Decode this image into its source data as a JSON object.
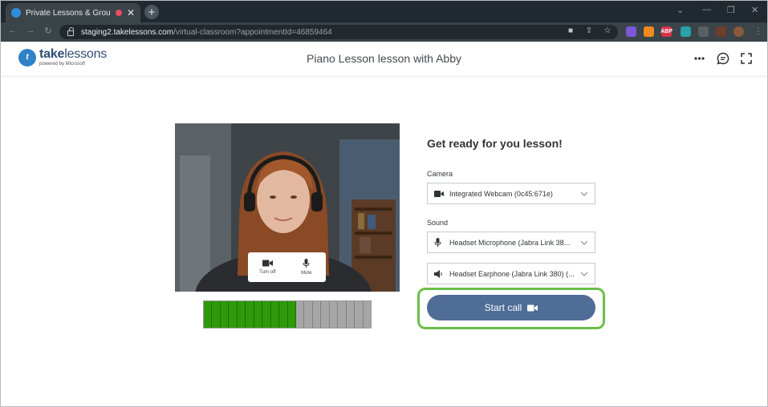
{
  "browser": {
    "tab_title": "Private Lessons & Group Cla",
    "tab_close": "✕",
    "new_tab": "+",
    "url_host": "staging2.takelessons.com",
    "url_path": "/virtual-classroom?appointmentId=46859464"
  },
  "header": {
    "logo_mark": "t",
    "logo_take": "take",
    "logo_lessons": "lessons",
    "logo_sub": "powered by Microsoft",
    "lesson_title": "Piano Lesson lesson with Abby",
    "more_icon": "more-horizontal-icon",
    "chat_icon": "chat-icon",
    "fullscreen_icon": "fullscreen-icon"
  },
  "video": {
    "camera_label": "Turn off",
    "mic_label": "Mute"
  },
  "meter": {
    "level": 0.55,
    "segments": 20
  },
  "panel": {
    "title": "Get ready for you lesson!",
    "camera_label": "Camera",
    "camera_value": "Integrated Webcam (0c45:671e)",
    "sound_label": "Sound",
    "microphone_value": "Headset Microphone (Jabra Link 38...",
    "speaker_value": "Headset Earphone (Jabra Link 380) (...",
    "start_label": "Start call"
  },
  "colors": {
    "accent_button": "#4f6d96",
    "highlight_outline": "#6abf49",
    "meter_on": "#2e9a0b",
    "meter_off": "#a6a6a6"
  }
}
